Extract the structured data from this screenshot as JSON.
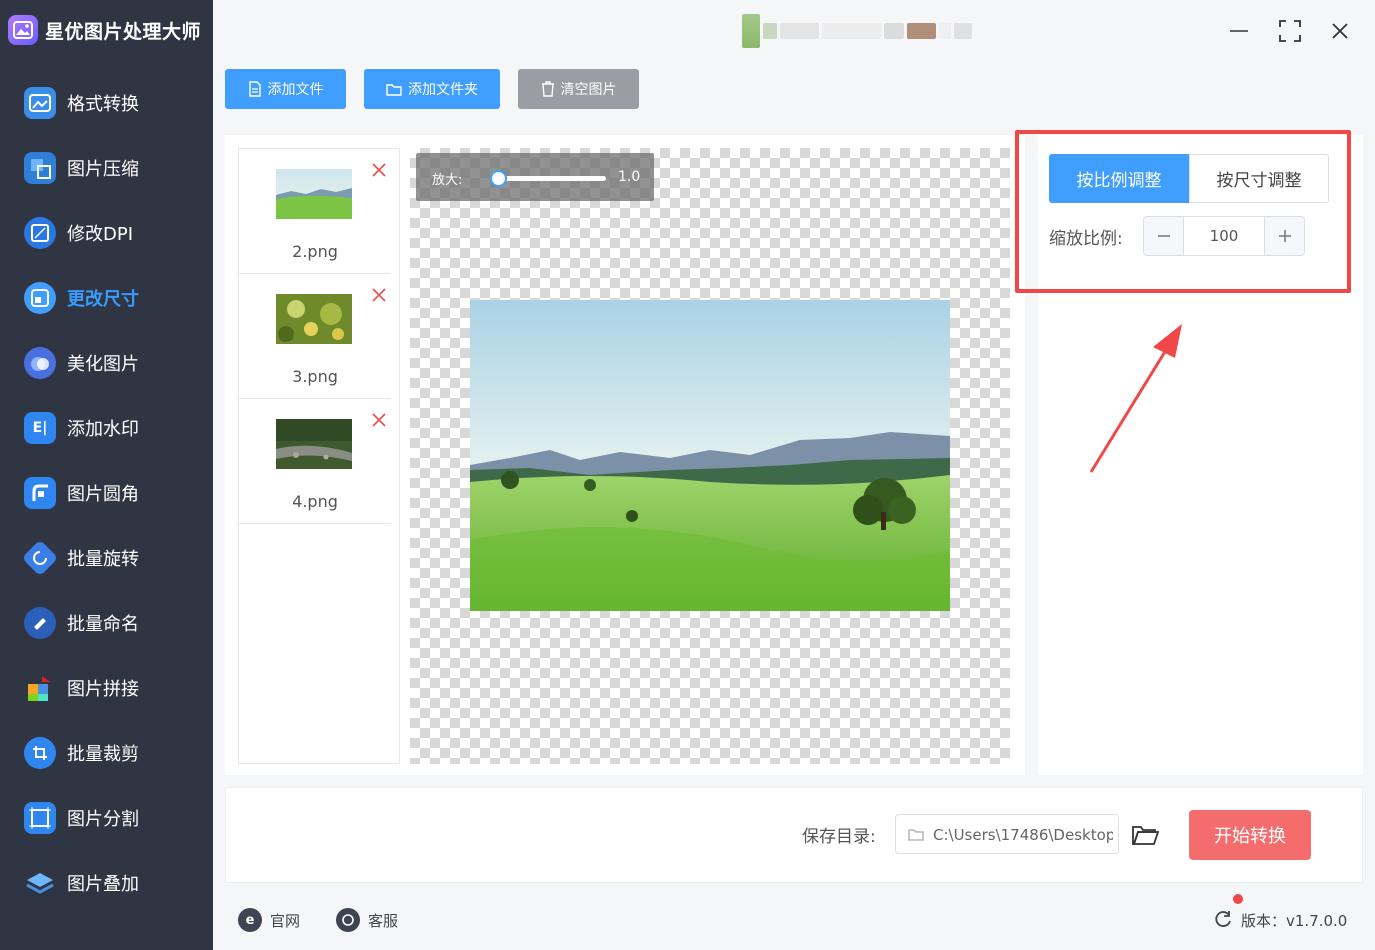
{
  "app": {
    "title": "星优图片处理大师"
  },
  "sidebar": {
    "items": [
      {
        "label": "格式转换",
        "icon": "image-convert-icon",
        "active": false
      },
      {
        "label": "图片压缩",
        "icon": "image-compress-icon",
        "active": false
      },
      {
        "label": "修改DPI",
        "icon": "dpi-icon",
        "active": false
      },
      {
        "label": "更改尺寸",
        "icon": "resize-icon",
        "active": true
      },
      {
        "label": "美化图片",
        "icon": "beautify-icon",
        "active": false
      },
      {
        "label": "添加水印",
        "icon": "watermark-icon",
        "active": false
      },
      {
        "label": "图片圆角",
        "icon": "rounded-corner-icon",
        "active": false
      },
      {
        "label": "批量旋转",
        "icon": "rotate-icon",
        "active": false
      },
      {
        "label": "批量命名",
        "icon": "rename-icon",
        "active": false
      },
      {
        "label": "图片拼接",
        "icon": "puzzle-icon",
        "active": false
      },
      {
        "label": "批量裁剪",
        "icon": "crop-icon",
        "active": false
      },
      {
        "label": "图片分割",
        "icon": "split-icon",
        "active": false
      },
      {
        "label": "图片叠加",
        "icon": "layers-icon",
        "active": false
      }
    ]
  },
  "toolbar": {
    "add_file": "添加文件",
    "add_folder": "添加文件夹",
    "clear": "清空图片"
  },
  "files": [
    {
      "name": "2.png",
      "thumb": "meadow"
    },
    {
      "name": "3.png",
      "thumb": "flowers"
    },
    {
      "name": "4.png",
      "thumb": "stream"
    }
  ],
  "preview": {
    "zoom_label": "放大:",
    "zoom_value": "1.0",
    "zoom_fraction": 0.0
  },
  "settings": {
    "tab_ratio": "按比例调整",
    "tab_size": "按尺寸调整",
    "scale_label": "缩放比例:",
    "scale_value": "100"
  },
  "save": {
    "label": "保存目录:",
    "path": "C:\\Users\\17486\\Desktop",
    "start_button": "开始转换"
  },
  "footer": {
    "website": "官网",
    "support": "客服",
    "version": "版本：v1.7.0.0"
  },
  "colors": {
    "accent": "#409eff",
    "danger": "#f56c6c",
    "highlight": "#f04848",
    "sidebar_bg": "#2f3542"
  }
}
